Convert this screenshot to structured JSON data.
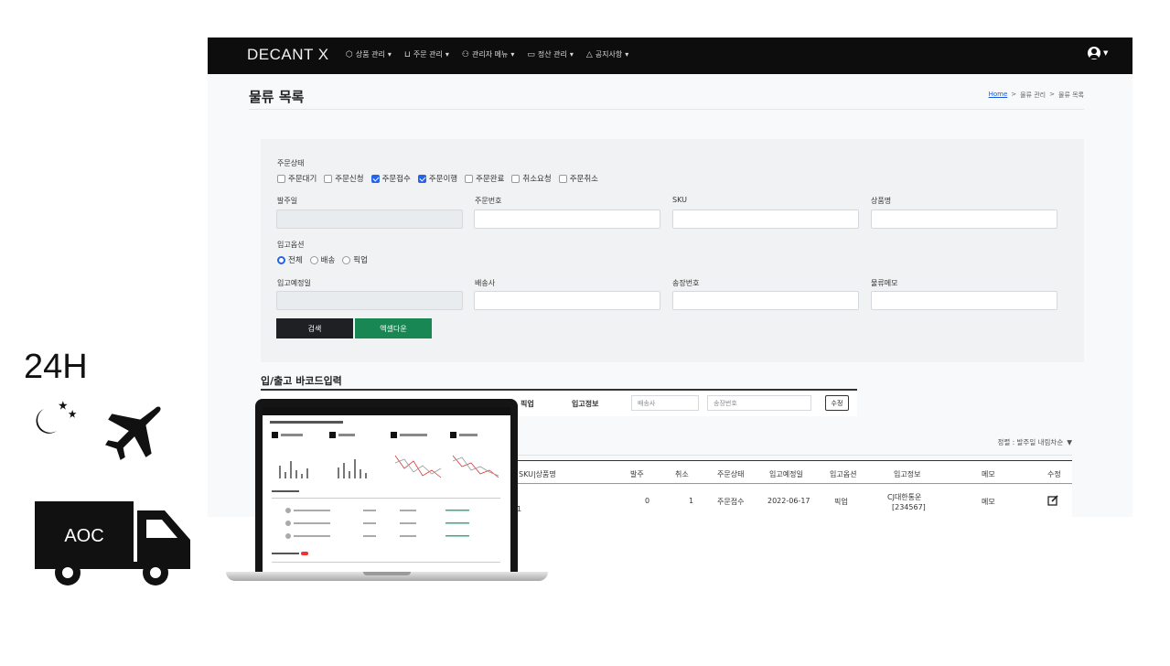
{
  "promo": {
    "hours": "24H",
    "truck_label": "AOC"
  },
  "nav": {
    "brand": "DECANT X",
    "menu": [
      {
        "label": "상품 관리",
        "icon": "box-icon"
      },
      {
        "label": "주문 관리",
        "icon": "cart-icon"
      },
      {
        "label": "관리자 메뉴",
        "icon": "user-icon"
      },
      {
        "label": "정산 관리",
        "icon": "card-icon"
      },
      {
        "label": "공지사항",
        "icon": "bell-icon"
      }
    ]
  },
  "page": {
    "title": "물류 목록",
    "breadcrumb": [
      "Home",
      "물류 관리",
      "물류 목록"
    ]
  },
  "filters": {
    "order_status_label": "주문상태",
    "order_status": [
      {
        "label": "주문대기",
        "checked": false
      },
      {
        "label": "주문신청",
        "checked": false
      },
      {
        "label": "주문접수",
        "checked": true
      },
      {
        "label": "주문이행",
        "checked": true
      },
      {
        "label": "주문완료",
        "checked": false
      },
      {
        "label": "취소요청",
        "checked": false
      },
      {
        "label": "주문취소",
        "checked": false
      }
    ],
    "order_date_label": "발주일",
    "order_no_label": "주문번호",
    "sku_label": "SKU",
    "product_label": "상품명",
    "inbound_option_label": "입고옵션",
    "inbound_options": [
      {
        "label": "전체",
        "selected": true
      },
      {
        "label": "배송",
        "selected": false
      },
      {
        "label": "픽업",
        "selected": false
      }
    ],
    "inbound_date_label": "입고예정일",
    "carrier_label": "배송사",
    "tracking_label": "송장번호",
    "memo_label": "물류메모",
    "search_button": "검색",
    "excel_button": "엑셀다운"
  },
  "barcode": {
    "title": "입/출고 바코드입력",
    "pickup_label": "픽업",
    "inbound_info_label": "입고정보",
    "carrier_placeholder": "배송사",
    "tracking_placeholder": "송장번호",
    "edit_button": "수정"
  },
  "table": {
    "sort_label": "정렬 : 발주일 내림차순",
    "headers": [
      "SKU|상품명",
      "발주",
      "취소",
      "주문상태",
      "입고예정일",
      "입고옵션",
      "입고정보",
      "메모",
      "수정"
    ],
    "rows": [
      {
        "col1": "1",
        "order": "0",
        "cancel": "1",
        "status": "주문접수",
        "date": "2022-06-17",
        "option": "픽업",
        "info1": "CJ대한통운",
        "info2": "[234567]",
        "memo": "메모"
      }
    ]
  },
  "colors": {
    "navbar": "#0d0d0d",
    "accent_blue": "#2563eb",
    "excel_green": "#198754",
    "search_dark": "#1e2024"
  }
}
